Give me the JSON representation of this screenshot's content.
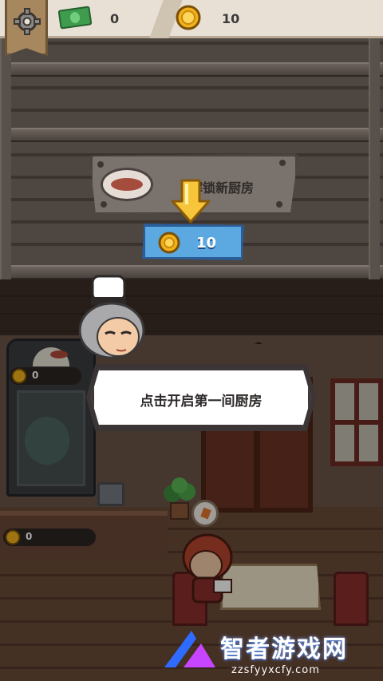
{
  "hud": {
    "cash_value": "0",
    "coin_value": "10",
    "icons": [
      "gear-icon",
      "cash-icon",
      "coin-icon"
    ]
  },
  "unlock": {
    "sign_title": "解锁新厨房",
    "cost": "10"
  },
  "restaurant": {
    "fridge_coins": "0",
    "counter_coins": "0"
  },
  "tutorial": {
    "message": "点击开启第一间厨房"
  },
  "watermark": {
    "name": "智者游戏网",
    "url": "zzsfyyxcfy.com"
  },
  "colors": {
    "button_blue": "#5ba9e0",
    "coin_gold": "#f2b21b",
    "arrow_yellow": "#f6c53a"
  }
}
